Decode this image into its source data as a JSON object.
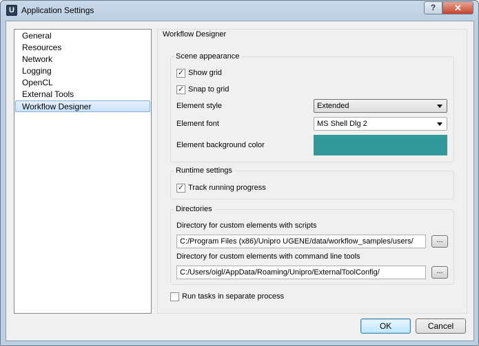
{
  "window": {
    "title": "Application Settings",
    "app_icon_letter": "U",
    "help_label": "?",
    "close_label": "✕"
  },
  "nav": {
    "items": [
      {
        "label": "General"
      },
      {
        "label": "Resources"
      },
      {
        "label": "Network"
      },
      {
        "label": "Logging"
      },
      {
        "label": "OpenCL"
      },
      {
        "label": "External Tools"
      },
      {
        "label": "Workflow Designer"
      }
    ],
    "selected": "Workflow Designer"
  },
  "page": {
    "title": "Workflow Designer",
    "scene": {
      "title": "Scene appearance",
      "show_grid": {
        "label": "Show grid",
        "checked": true
      },
      "snap_to_grid": {
        "label": "Snap to grid",
        "checked": true
      },
      "element_style": {
        "label": "Element style",
        "value": "Extended"
      },
      "element_font": {
        "label": "Element font",
        "value": "MS Shell Dlg 2"
      },
      "element_bg": {
        "label": "Element background color",
        "color": "#339999"
      }
    },
    "runtime": {
      "title": "Runtime settings",
      "track_progress": {
        "label": "Track running progress",
        "checked": true
      }
    },
    "directories": {
      "title": "Directories",
      "scripts_label": "Directory for custom elements with scripts",
      "scripts_path": "C:/Program Files (x86)/Unipro UGENE/data/workflow_samples/users/",
      "tools_label": "Directory for custom elements with command line tools",
      "tools_path": "C:/Users/oigl/AppData/Roaming/Unipro/ExternalToolConfig/",
      "browse_label": "..."
    },
    "run_separate": {
      "label": "Run tasks in separate process",
      "checked": false
    }
  },
  "buttons": {
    "ok": "OK",
    "cancel": "Cancel"
  },
  "check_glyph": "✓"
}
